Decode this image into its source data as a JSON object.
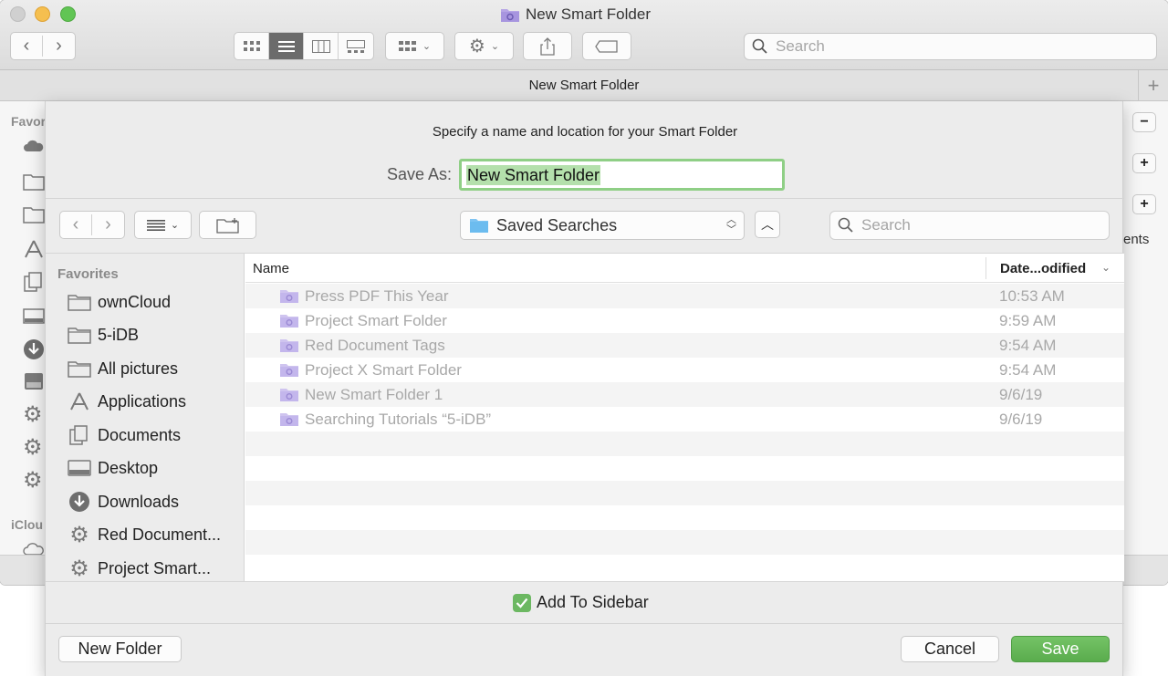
{
  "window": {
    "title": "New Smart Folder",
    "path_title": "New Smart Folder"
  },
  "finder_toolbar": {
    "search_placeholder": "Search"
  },
  "finder_sidebar": {
    "favorites_label_partial": "Favor",
    "icloud_label_partial": "iClou"
  },
  "finder_right": {
    "partial_column": "ents"
  },
  "sheet": {
    "prompt": "Specify a name and location for your Smart Folder",
    "save_as_label": "Save As:",
    "save_as_value": "New Smart Folder",
    "location": "Saved Searches",
    "search_placeholder": "Search"
  },
  "sidebar": {
    "header": "Favorites",
    "items": [
      {
        "label": "ownCloud",
        "icon": "folder-icon"
      },
      {
        "label": "5-iDB",
        "icon": "folder-icon"
      },
      {
        "label": "All pictures",
        "icon": "folder-icon"
      },
      {
        "label": "Applications",
        "icon": "applications-icon"
      },
      {
        "label": "Documents",
        "icon": "documents-icon"
      },
      {
        "label": "Desktop",
        "icon": "desktop-icon"
      },
      {
        "label": "Downloads",
        "icon": "downloads-icon"
      },
      {
        "label": "Red Document...",
        "icon": "gear-icon"
      },
      {
        "label": "Project Smart...",
        "icon": "gear-icon"
      }
    ]
  },
  "list": {
    "columns": {
      "name": "Name",
      "date": "Date...odified"
    },
    "rows": [
      {
        "name": "Press PDF This Year",
        "date": "10:53 AM"
      },
      {
        "name": "Project Smart Folder",
        "date": "9:59 AM"
      },
      {
        "name": "Red Document Tags",
        "date": "9:54 AM"
      },
      {
        "name": "Project X Smart Folder",
        "date": "9:54 AM"
      },
      {
        "name": "New Smart Folder 1",
        "date": "9/6/19"
      },
      {
        "name": "Searching Tutorials “5-iDB”",
        "date": "9/6/19"
      }
    ]
  },
  "footer": {
    "add_to_sidebar_label": "Add To Sidebar",
    "add_to_sidebar_checked": true,
    "new_folder": "New Folder",
    "cancel": "Cancel",
    "save": "Save"
  },
  "colors": {
    "accent_green": "#5aac4d",
    "smart_folder_purple": "#b7a6e6",
    "folder_blue": "#6cbcef"
  }
}
